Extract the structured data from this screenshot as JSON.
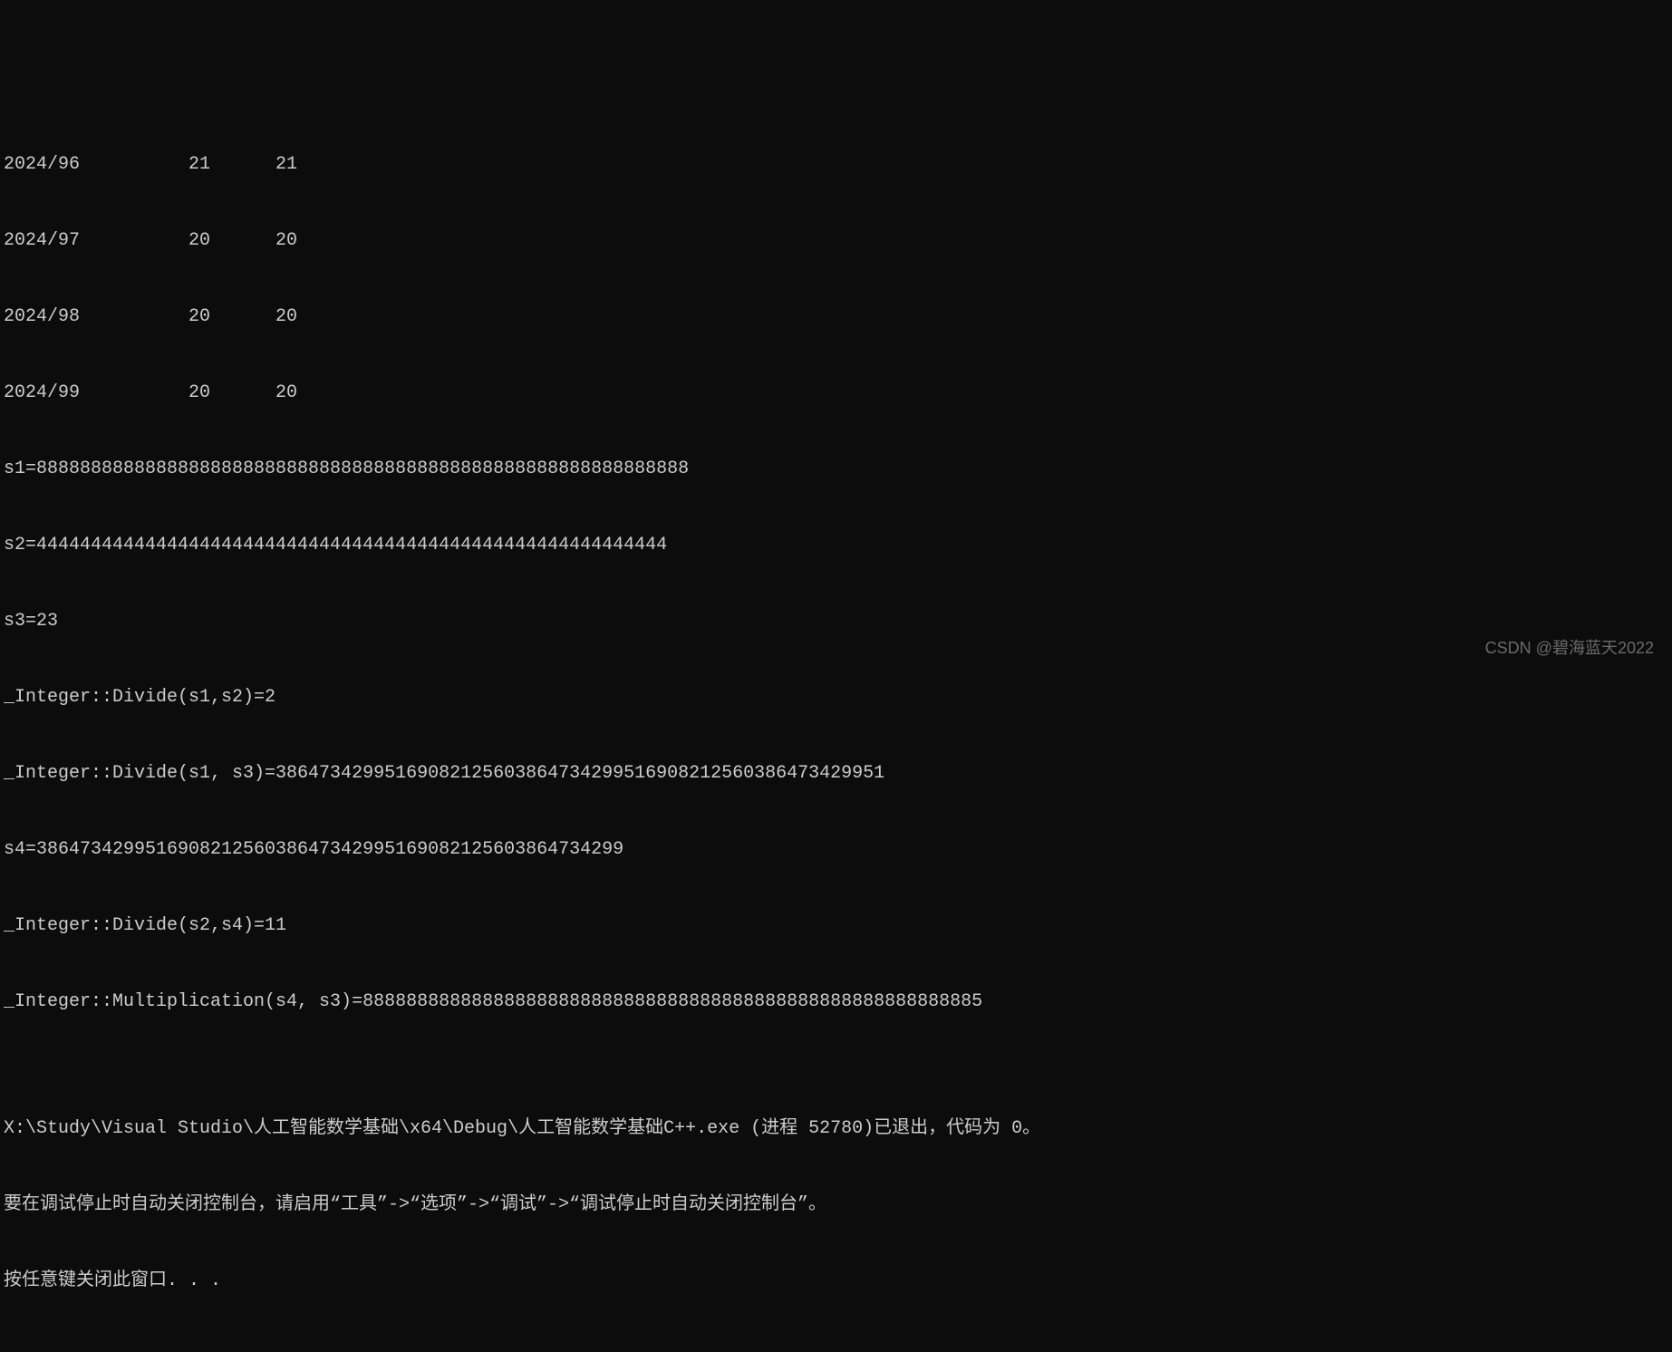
{
  "console": {
    "lines": [
      "2024/96          21      21",
      "2024/97          20      20",
      "2024/98          20      20",
      "2024/99          20      20",
      "s1=888888888888888888888888888888888888888888888888888888888888",
      "s2=4444444444444444444444444444444444444444444444444444444444",
      "s3=23",
      "_Integer::Divide(s1,s2)=2",
      "_Integer::Divide(s1, s3)=38647342995169082125603864734299516908212560386473429951",
      "s4=386473429951690821256038647342995169082125603864734299",
      "_Integer::Divide(s2,s4)=11",
      "_Integer::Multiplication(s4, s3)=888888888888888888888888888888888888888888888888888888885",
      "",
      "X:\\Study\\Visual Studio\\人工智能数学基础\\x64\\Debug\\人工智能数学基础C++.exe (进程 52780)已退出，代码为 0。",
      "要在调试停止时自动关闭控制台，请启用“工具”->“选项”->“调试”->“调试停止时自动关闭控制台”。",
      "按任意键关闭此窗口. . ."
    ]
  },
  "watermark": "CSDN @碧海蓝天2022"
}
